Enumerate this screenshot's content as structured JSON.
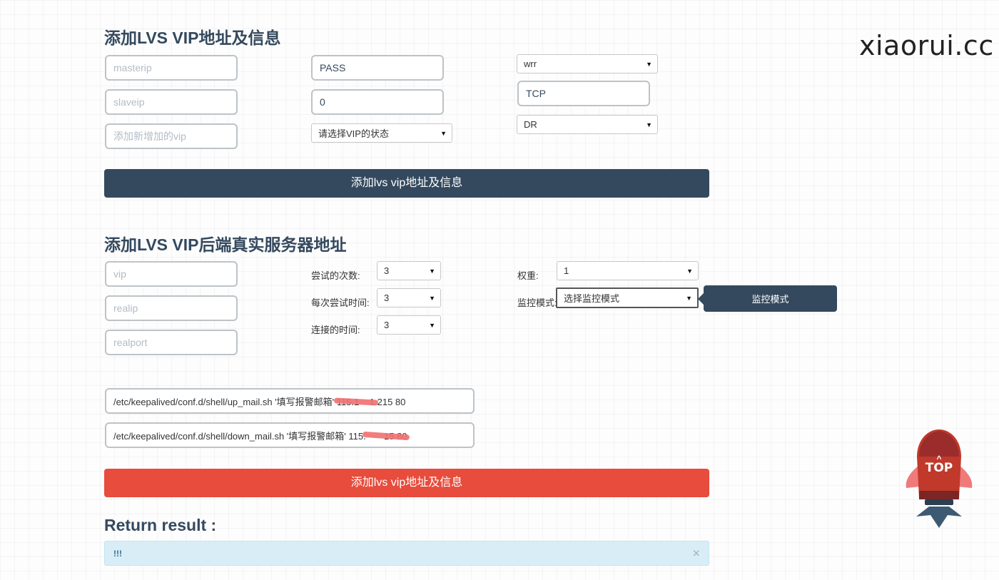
{
  "brand": "xiaorui.cc",
  "section1": {
    "title": "添加LVS VIP地址及信息",
    "masterip_placeholder": "masterip",
    "slaveip_placeholder": "slaveip",
    "vip_placeholder": "添加新增加的vip",
    "auth_value": "PASS",
    "priority_value": "0",
    "vip_state_select": "请选择VIP的状态",
    "lb_algo_select": "wrr",
    "protocol_value": "TCP",
    "lb_kind_select": "DR",
    "submit_label": "添加lvs vip地址及信息"
  },
  "section2": {
    "title": "添加LVS VIP后端真实服务器地址",
    "vip_placeholder": "vip",
    "realip_placeholder": "realip",
    "realport_placeholder": "realport",
    "retry_label": "尝试的次数:",
    "retry_value": "3",
    "delay_label": "每次尝试时间:",
    "delay_value": "3",
    "connect_label": "连接的时间:",
    "connect_value": "3",
    "weight_label": "权重:",
    "weight_value": "1",
    "monitor_label": "监控模式:",
    "monitor_select": "选择监控模式",
    "monitor_button": "监控模式",
    "notify_up": "/etc/keepalived/conf.d/shell/up_mail.sh '填写报警邮箱' 115.1    1.215 80",
    "notify_down": "/etc/keepalived/conf.d/shell/down_mail.sh '填写报警邮箱' 115.       15 80",
    "submit_label": "添加lvs vip地址及信息"
  },
  "result": {
    "title": "Return result :",
    "message": "!!!",
    "close_glyph": "×"
  },
  "top_button": {
    "label": "TOP",
    "chevron": "^"
  }
}
